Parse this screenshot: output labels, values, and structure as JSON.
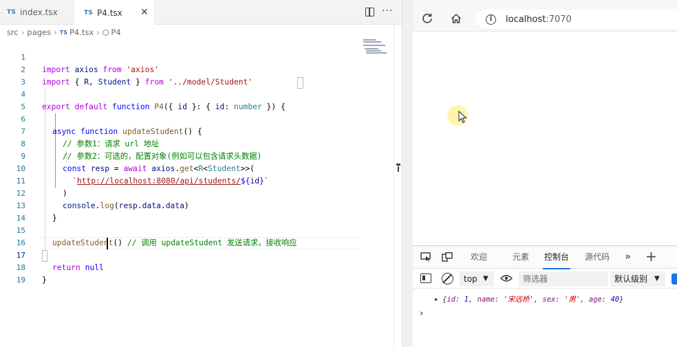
{
  "editor": {
    "tabs": [
      {
        "lang": "TS",
        "label": "index.tsx"
      },
      {
        "lang": "TS",
        "label": "P4.tsx",
        "close": "✕"
      }
    ],
    "more_actions": "···",
    "breadcrumb": {
      "part1": "src",
      "part2": "pages",
      "file_lang": "TS",
      "file": "P4.tsx",
      "symbol": "P4"
    },
    "line_numbers": [
      "1",
      "2",
      "3",
      "4",
      "5",
      "6",
      "7",
      "8",
      "9",
      "10",
      "11",
      "12",
      "13",
      "14",
      "15",
      "16",
      "17",
      "18",
      "19"
    ],
    "code": {
      "l1": {
        "kw1": "import",
        "id": " axios ",
        "kw2": "from",
        "sp": " ",
        "str": "'axios'"
      },
      "l2": {
        "kw1": "import",
        "p1": " { ",
        "id1": "R",
        "p2": ", ",
        "id2": "Student",
        "p3": " } ",
        "kw2": "from",
        "sp": " ",
        "str": "'../model/Student'"
      },
      "l4": {
        "kw1": "export",
        "kw2": " default",
        "kw3": " function",
        "sp": " ",
        "fn": "P4",
        "p1": "({ ",
        "id": "id",
        "p2": " }: { ",
        "id2": "id",
        "p3": ": ",
        "ty": "number",
        "p4": " }) {"
      },
      "l6": {
        "kw1": "async",
        "kw2": " function",
        "sp": " ",
        "fn": "updateStudent",
        "p1": "() {"
      },
      "l7": "// 参数1：请求 url 地址",
      "l8": "// 参数2：可选的，配置对象(例如可以包含请求头数据)",
      "l9": {
        "kw1": "const",
        "sp": " ",
        "id": "resp",
        "p1": " = ",
        "kw2": "await",
        "sp2": " ",
        "id2": "axios",
        "p2": ".",
        "fn": "get",
        "p3": "<",
        "ty1": "R",
        "p4": "<",
        "ty2": "Student",
        "p5": ">>("
      },
      "l10": {
        "tick": "`",
        "url": "http://localhost:8080/api/students/",
        "interp": "${",
        "id": "id",
        "interp_end": "}",
        "tick2": "`"
      },
      "l11": ")",
      "l12": {
        "id": "console",
        "p1": ".",
        "fn": "log",
        "p2": "(",
        "id2": "resp",
        "p3": ".",
        "id3": "data",
        "p4": ".",
        "id4": "data",
        "p5": ")"
      },
      "l13": "}",
      "l15": {
        "fn": "updateStudent",
        "p1": "() ",
        "cm": "// 调用 updateStudent 发送请求，接收响应"
      },
      "l17": {
        "kw": "return",
        "sp": " ",
        "lit": "null"
      },
      "l18": "}"
    }
  },
  "browser": {
    "url_host": "localhost",
    "url_port": ":7070",
    "info_glyph": "i",
    "devtools": {
      "tabs": [
        "欢迎",
        "元素",
        "控制台",
        "源代码"
      ],
      "more": "»",
      "plus": "+",
      "context": "top",
      "caret": "▼",
      "filter_placeholder": "筛选器",
      "level": "默认级别",
      "log": {
        "open": "{",
        "k1": "id",
        "c1": ": ",
        "v1": "1",
        "s1": ", ",
        "k2": "name",
        "c2": ": ",
        "v2": "'宋远桥'",
        "s2": ", ",
        "k3": "sex",
        "c3": ": ",
        "v3": "'男'",
        "s3": ", ",
        "k4": "age",
        "c4": ": ",
        "v4": "40",
        "close": "}",
        "expand": "▶"
      },
      "prompt": "›"
    }
  },
  "colors": {
    "keyword": "#0000ff",
    "string": "#a31515",
    "comment": "#008000",
    "accent": "#1a73e8"
  }
}
